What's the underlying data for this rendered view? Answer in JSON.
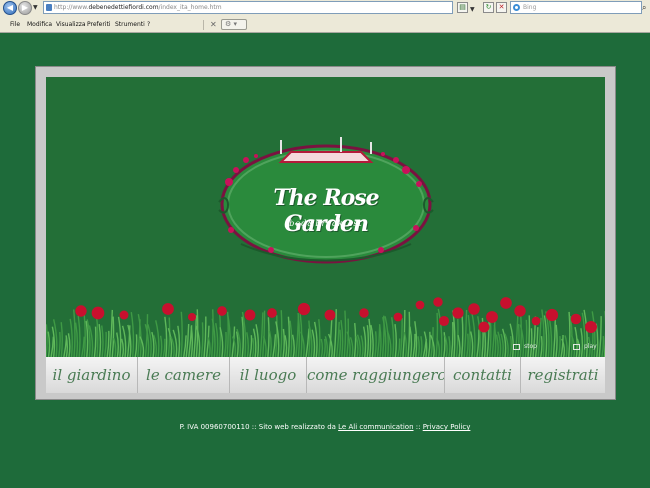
{
  "browser": {
    "address_prefix": "http://www.",
    "address_host": "debenedettiefiordi.com",
    "address_path": "/index_ita_home.htm",
    "search_placeholder": "Bing",
    "menu": [
      "File",
      "Modifica",
      "Visualizza",
      "Preferiti",
      "Strumenti",
      "?"
    ]
  },
  "site": {
    "logo_title": "The Rose Garden",
    "logo_subtitle": "bed&breakfast",
    "slideshow": {
      "stop_label": "stop",
      "play_label": "play"
    },
    "nav": [
      "il giardino",
      "le camere",
      "il luogo",
      "come raggiungerci",
      "contatti",
      "registrati"
    ],
    "footer": {
      "text_before": "P. IVA 00960700110 :: Sito web realizzato da ",
      "agency_link": "Le Ali communication",
      "separator": " :: ",
      "privacy_link": "Privacy Policy"
    }
  },
  "colors": {
    "page_background": "#1e6b3a",
    "stage_background": "#236f37",
    "nav_text": "#4a7b54",
    "rose": "#c8102e"
  }
}
